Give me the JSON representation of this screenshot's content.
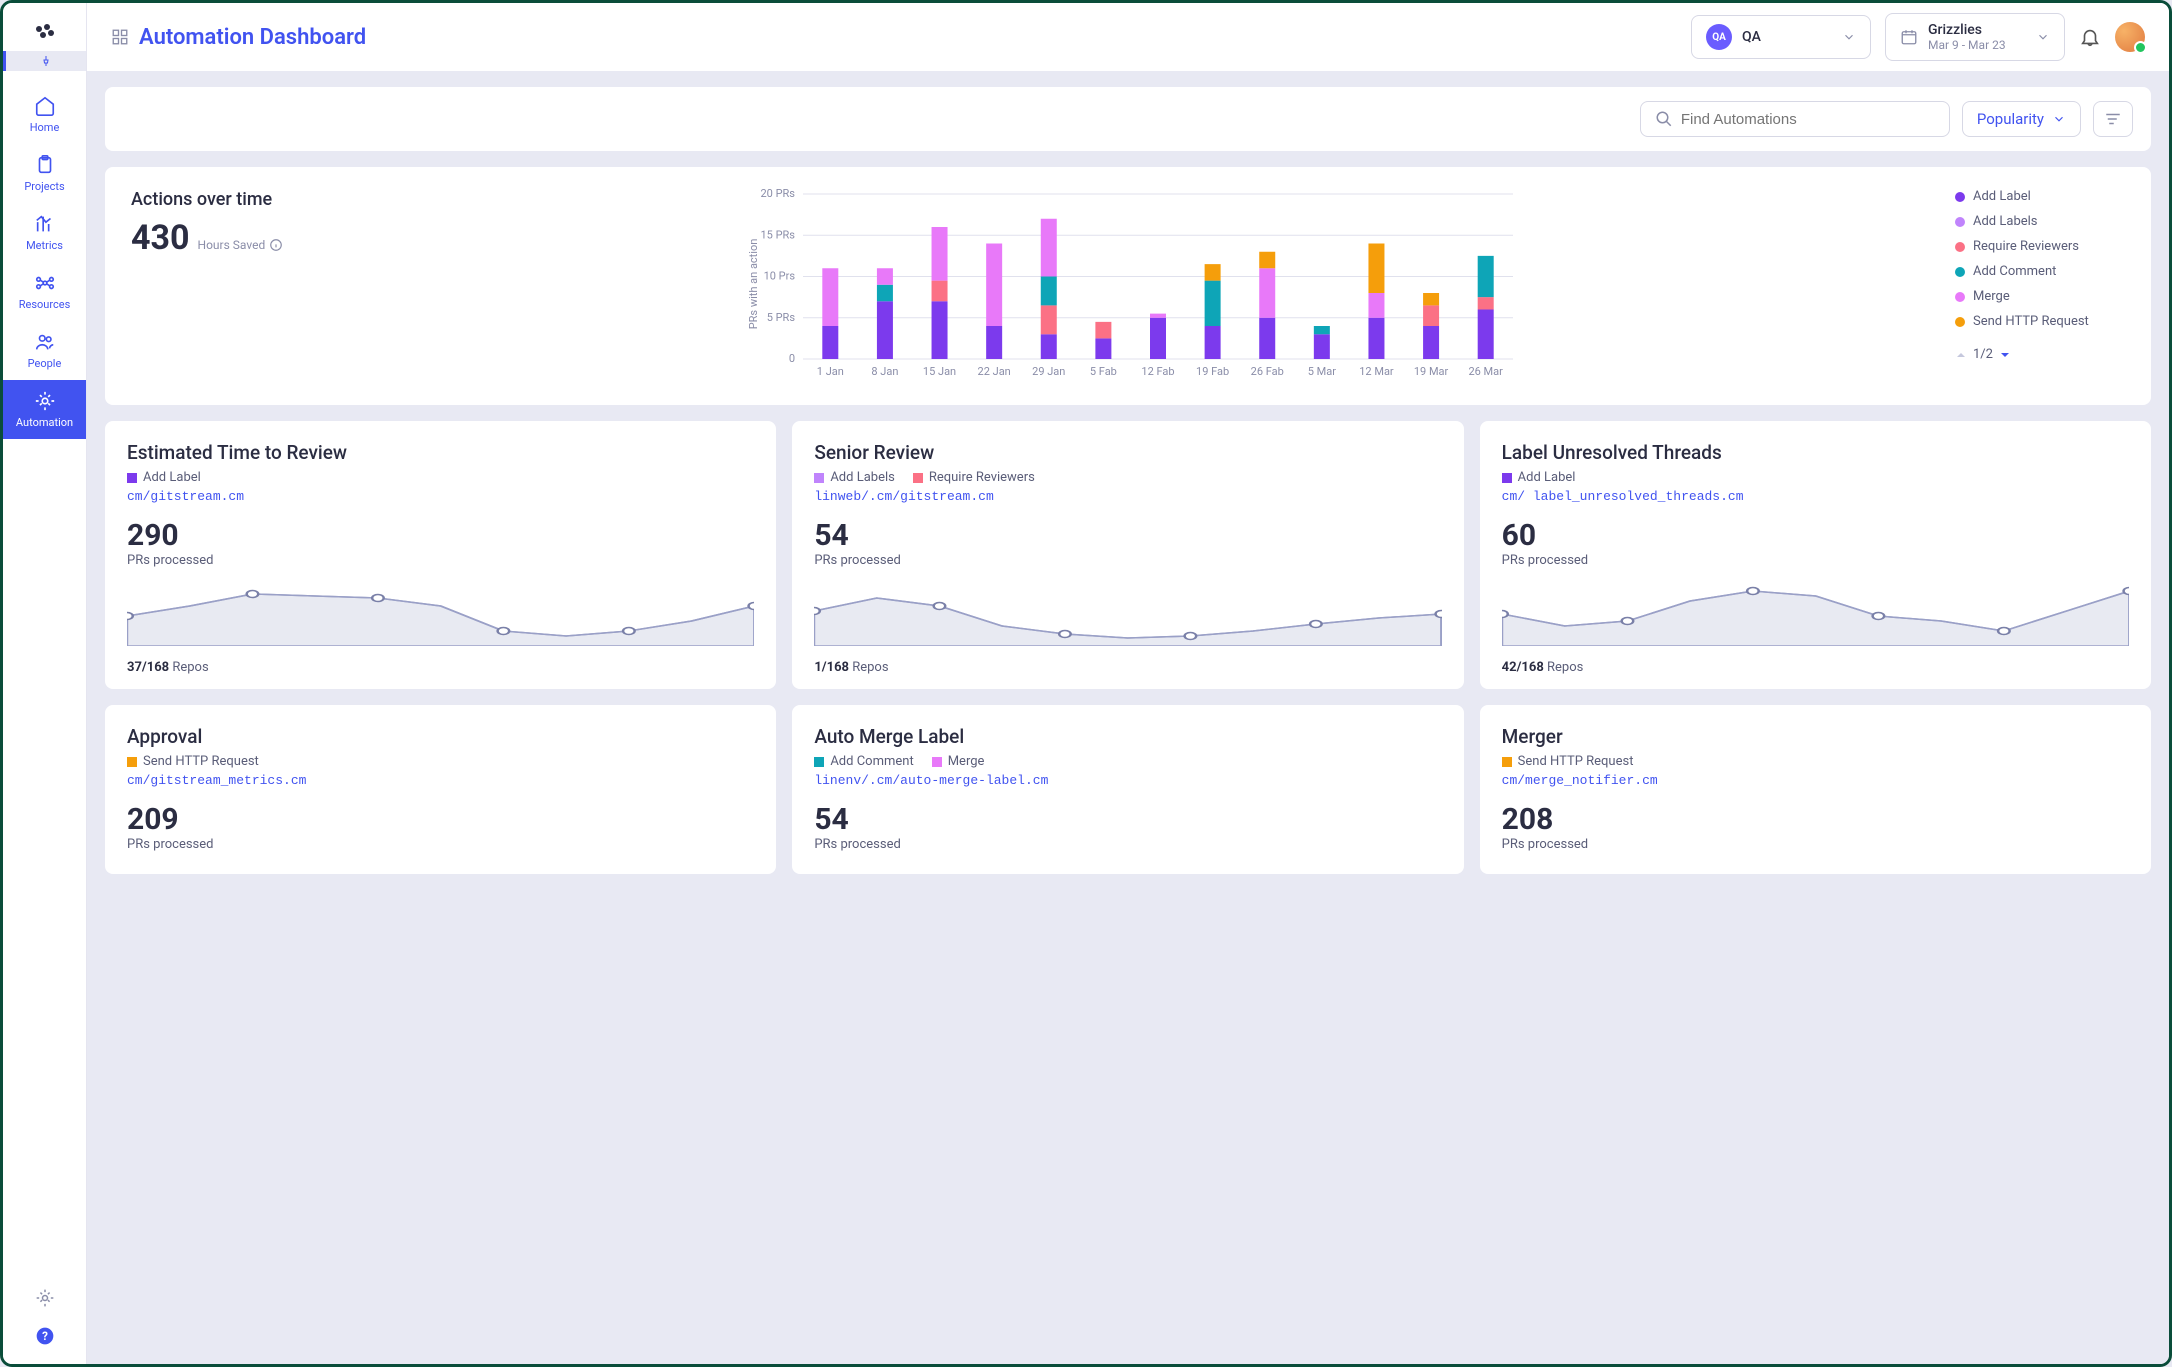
{
  "header": {
    "title": "Automation Dashboard",
    "team_badge": "QA",
    "team_label": "QA",
    "range_name": "Grizzlies",
    "range_dates": "Mar 9 - Mar 23"
  },
  "nav": {
    "home": "Home",
    "projects": "Projects",
    "metrics": "Metrics",
    "resources": "Resources",
    "people": "People",
    "automation": "Automation"
  },
  "filter": {
    "search_placeholder": "Find Automations",
    "sort_label": "Popularity"
  },
  "chart": {
    "title": "Actions over time",
    "hours_value": "430",
    "hours_label": "Hours Saved",
    "y_axis_title": "PRs with an action",
    "pager": "1/2",
    "legend": [
      {
        "color": "#7c3aed",
        "label": "Add Label"
      },
      {
        "color": "#c084fc",
        "label": "Add Labels"
      },
      {
        "color": "#fb7185",
        "label": "Require Reviewers"
      },
      {
        "color": "#0ea5b7",
        "label": "Add Comment"
      },
      {
        "color": "#e879f9",
        "label": "Merge"
      },
      {
        "color": "#f59e0b",
        "label": "Send HTTP Request"
      }
    ]
  },
  "chart_data": {
    "type": "bar",
    "xlabel": "",
    "ylabel": "PRs with an action",
    "ylim": [
      0,
      20
    ],
    "yticks": [
      0,
      5,
      10,
      15,
      20
    ],
    "ytick_labels": [
      "0",
      "5 PRs",
      "10 Prs",
      "15 PRs",
      "20 PRs"
    ],
    "categories": [
      "1 Jan",
      "8 Jan",
      "15 Jan",
      "22 Jan",
      "29 Jan",
      "5 Fab",
      "12 Fab",
      "19 Fab",
      "26 Fab",
      "5 Mar",
      "12 Mar",
      "19 Mar",
      "26 Mar"
    ],
    "series": [
      {
        "name": "Add Label",
        "color": "#7c3aed",
        "values": [
          4,
          7,
          7,
          4,
          3,
          2.5,
          5,
          4,
          5,
          3,
          5,
          4,
          6
        ]
      },
      {
        "name": "Add Labels",
        "color": "#c084fc",
        "values": [
          0,
          0,
          0,
          0,
          0,
          0,
          0,
          0,
          0,
          0,
          0,
          0,
          0
        ]
      },
      {
        "name": "Require Reviewers",
        "color": "#fb7185",
        "values": [
          0,
          0,
          2.5,
          0,
          3.5,
          2,
          0,
          0,
          0,
          0,
          0,
          2.5,
          1.5
        ]
      },
      {
        "name": "Add Comment",
        "color": "#0ea5b7",
        "values": [
          0,
          2,
          0,
          0,
          3.5,
          0,
          0,
          5.5,
          0,
          1,
          0,
          0,
          5
        ]
      },
      {
        "name": "Merge",
        "color": "#e879f9",
        "values": [
          7,
          2,
          6.5,
          10,
          7,
          0,
          0.5,
          0,
          6,
          0,
          3,
          0,
          0
        ]
      },
      {
        "name": "Send HTTP Request",
        "color": "#f59e0b",
        "values": [
          0,
          0,
          0,
          0,
          0,
          0,
          0,
          2,
          2,
          0,
          6,
          1.5,
          0
        ]
      }
    ]
  },
  "cards": [
    {
      "title": "Estimated Time to Review",
      "tags": [
        {
          "color": "#7c3aed",
          "label": "Add Label"
        }
      ],
      "path": "cm/gitstream.cm",
      "value": "290",
      "sub": "PRs processed",
      "repos_bold": "37/168",
      "repos_rest": " Repos",
      "spark": [
        40,
        30,
        18,
        20,
        22,
        30,
        55,
        60,
        55,
        45,
        30
      ]
    },
    {
      "title": "Senior Review",
      "tags": [
        {
          "color": "#c084fc",
          "label": "Add Labels"
        },
        {
          "color": "#fb7185",
          "label": "Require Reviewers"
        }
      ],
      "path": "linweb/.cm/gitstream.cm",
      "value": "54",
      "sub": "PRs processed",
      "repos_bold": "1/168",
      "repos_rest": " Repos",
      "spark": [
        35,
        22,
        30,
        50,
        58,
        62,
        60,
        55,
        48,
        42,
        38
      ]
    },
    {
      "title": "Label Unresolved Threads",
      "tags": [
        {
          "color": "#7c3aed",
          "label": "Add Label"
        }
      ],
      "path": "cm/ label_unresolved_threads.cm",
      "value": "60",
      "sub": "PRs processed",
      "repos_bold": "42/168",
      "repos_rest": " Repos",
      "spark": [
        38,
        50,
        45,
        25,
        15,
        20,
        40,
        45,
        55,
        35,
        15
      ]
    },
    {
      "title": "Approval",
      "tags": [
        {
          "color": "#f59e0b",
          "label": "Send HTTP Request"
        }
      ],
      "path": "cm/gitstream_metrics.cm",
      "value": "209",
      "sub": "PRs processed",
      "repos_bold": "",
      "repos_rest": "",
      "spark": []
    },
    {
      "title": "Auto Merge Label",
      "tags": [
        {
          "color": "#0ea5b7",
          "label": "Add Comment"
        },
        {
          "color": "#e879f9",
          "label": "Merge"
        }
      ],
      "path": "linenv/.cm/auto-merge-label.cm",
      "value": "54",
      "sub": "PRs processed",
      "repos_bold": "",
      "repos_rest": "",
      "spark": []
    },
    {
      "title": "Merger",
      "tags": [
        {
          "color": "#f59e0b",
          "label": "Send HTTP Request"
        }
      ],
      "path": "cm/merge_notifier.cm",
      "value": "208",
      "sub": "PRs processed",
      "repos_bold": "",
      "repos_rest": "",
      "spark": []
    }
  ]
}
